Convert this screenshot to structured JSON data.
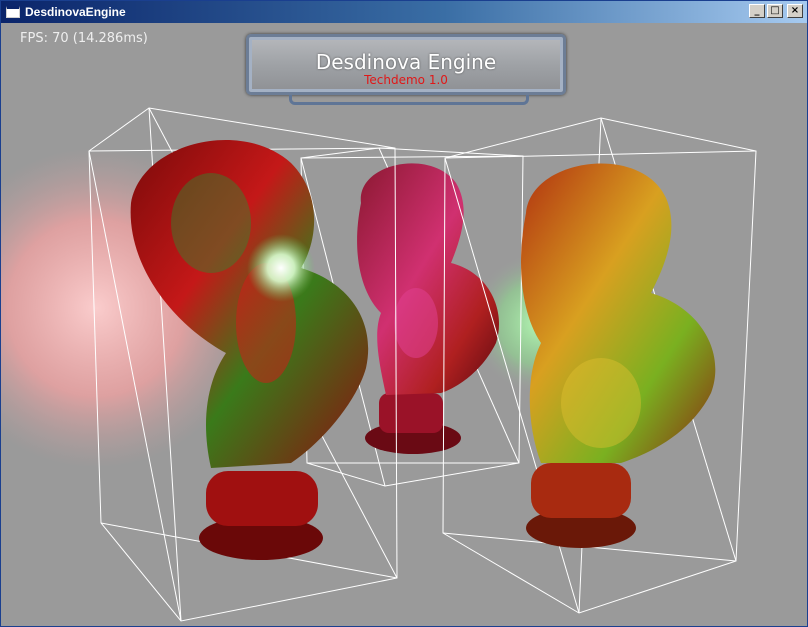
{
  "window": {
    "title": "DesdinovaEngine",
    "buttons": {
      "minimize": "_",
      "maximize": "□",
      "close": "×"
    }
  },
  "hud": {
    "fps": "FPS: 70 (14.286ms)"
  },
  "logo": {
    "title": "Desdinova Engine",
    "subtitle": "Techdemo 1.0"
  },
  "colors": {
    "titlebar_start": "#0a246a",
    "titlebar_end": "#a6caf0",
    "background": "#9a9a9a",
    "subtitle_red": "#e01818",
    "wireframe": "#ffffff",
    "red_light": "#ff8a8a",
    "green_light": "#7cff7c"
  }
}
